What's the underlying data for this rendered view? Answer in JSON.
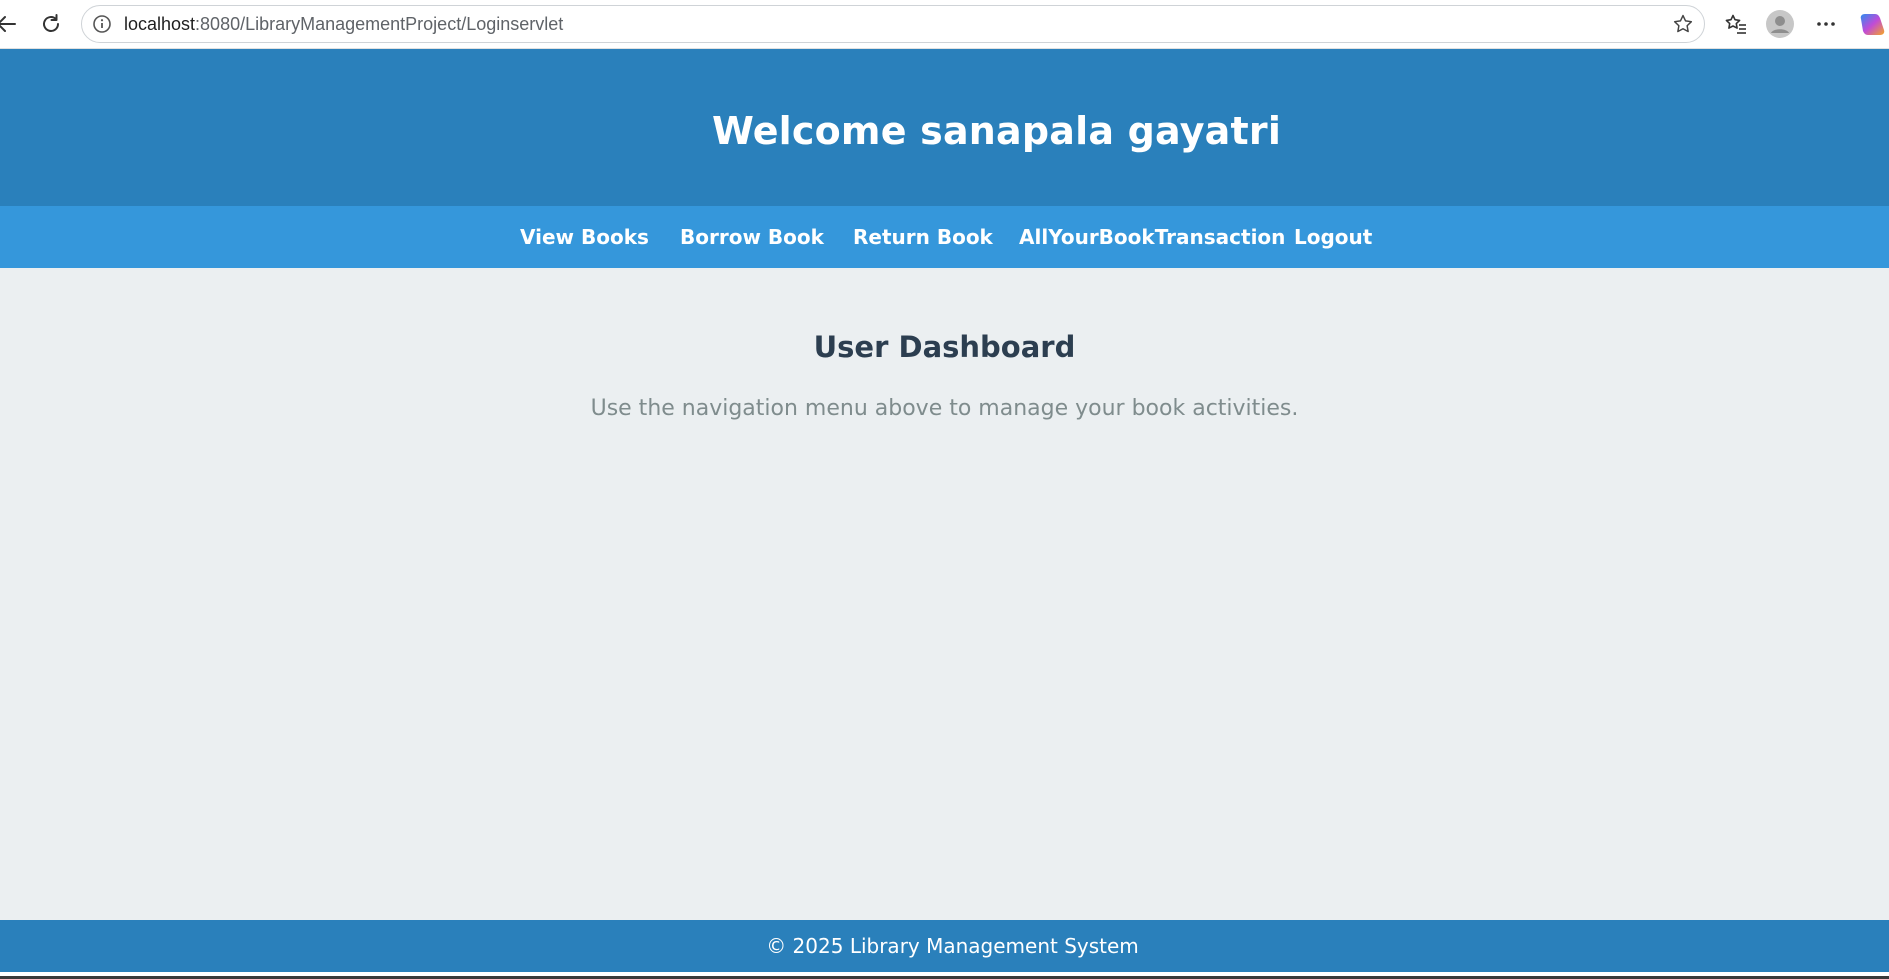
{
  "browser": {
    "url_host": "localhost",
    "url_rest": ":8080/LibraryManagementProject/Loginservlet",
    "back_icon": "back-arrow-icon",
    "reload_icon": "reload-icon"
  },
  "header": {
    "title": "Welcome sanapala gayatri"
  },
  "nav": {
    "items": [
      {
        "label": "View Books"
      },
      {
        "label": "Borrow Book"
      },
      {
        "label": "Return Book"
      },
      {
        "label": "AllYourBookTransaction"
      },
      {
        "label": "Logout"
      }
    ]
  },
  "main": {
    "title": "User Dashboard",
    "subtitle": "Use the navigation menu above to manage your book activities."
  },
  "footer": {
    "text": "© 2025 Library Management System"
  },
  "colors": {
    "header_bg": "#2a80bb",
    "nav_bg": "#3597db",
    "page_bg": "#ebeff1",
    "title_text": "#2c3e50",
    "muted_text": "#7f8c8d"
  }
}
